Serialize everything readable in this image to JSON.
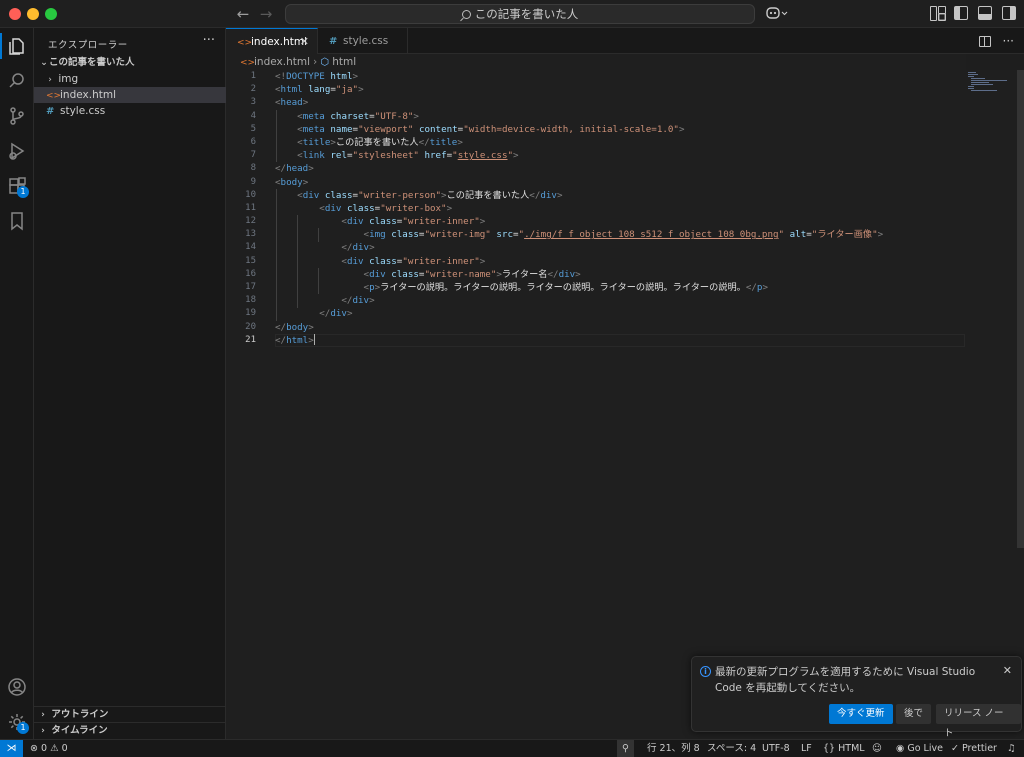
{
  "window": {
    "search_title": "この記事を書いた人"
  },
  "sidebar": {
    "header": "エクスプローラー",
    "more": "···",
    "folder": "この記事を書いた人",
    "items": [
      {
        "label": "img",
        "type": "folder"
      },
      {
        "label": "index.html",
        "type": "html"
      },
      {
        "label": "style.css",
        "type": "css"
      }
    ],
    "outline": "アウトライン",
    "timeline": "タイムライン"
  },
  "activity": {
    "extensions_badge": "1",
    "settings_badge": "1"
  },
  "tabs": [
    {
      "label": "index.html",
      "icon": "<>"
    },
    {
      "label": "style.css",
      "icon": "#"
    }
  ],
  "breadcrumb": {
    "file": "index.html",
    "symbol": "html"
  },
  "editor": {
    "line_numbers": [
      "1",
      "2",
      "3",
      "4",
      "5",
      "6",
      "7",
      "8",
      "9",
      "10",
      "11",
      "12",
      "13",
      "14",
      "15",
      "16",
      "17",
      "18",
      "19",
      "20",
      "21"
    ],
    "current_line": "21"
  },
  "notification": {
    "message": "最新の更新プログラムを適用するために Visual Studio Code を再起動してください。",
    "primary": "今すぐ更新",
    "later": "後で",
    "notes": "リリース ノート"
  },
  "status": {
    "errors": "0",
    "warnings": "0",
    "position": "行 21、列 8",
    "spaces": "スペース: 4",
    "encoding": "UTF-8",
    "eol": "LF",
    "language": "HTML",
    "golive": "Go Live",
    "prettier": "Prettier"
  },
  "colors": {
    "accent": "#0078d4",
    "background": "#1f1f1f",
    "sidebar": "#181818"
  }
}
